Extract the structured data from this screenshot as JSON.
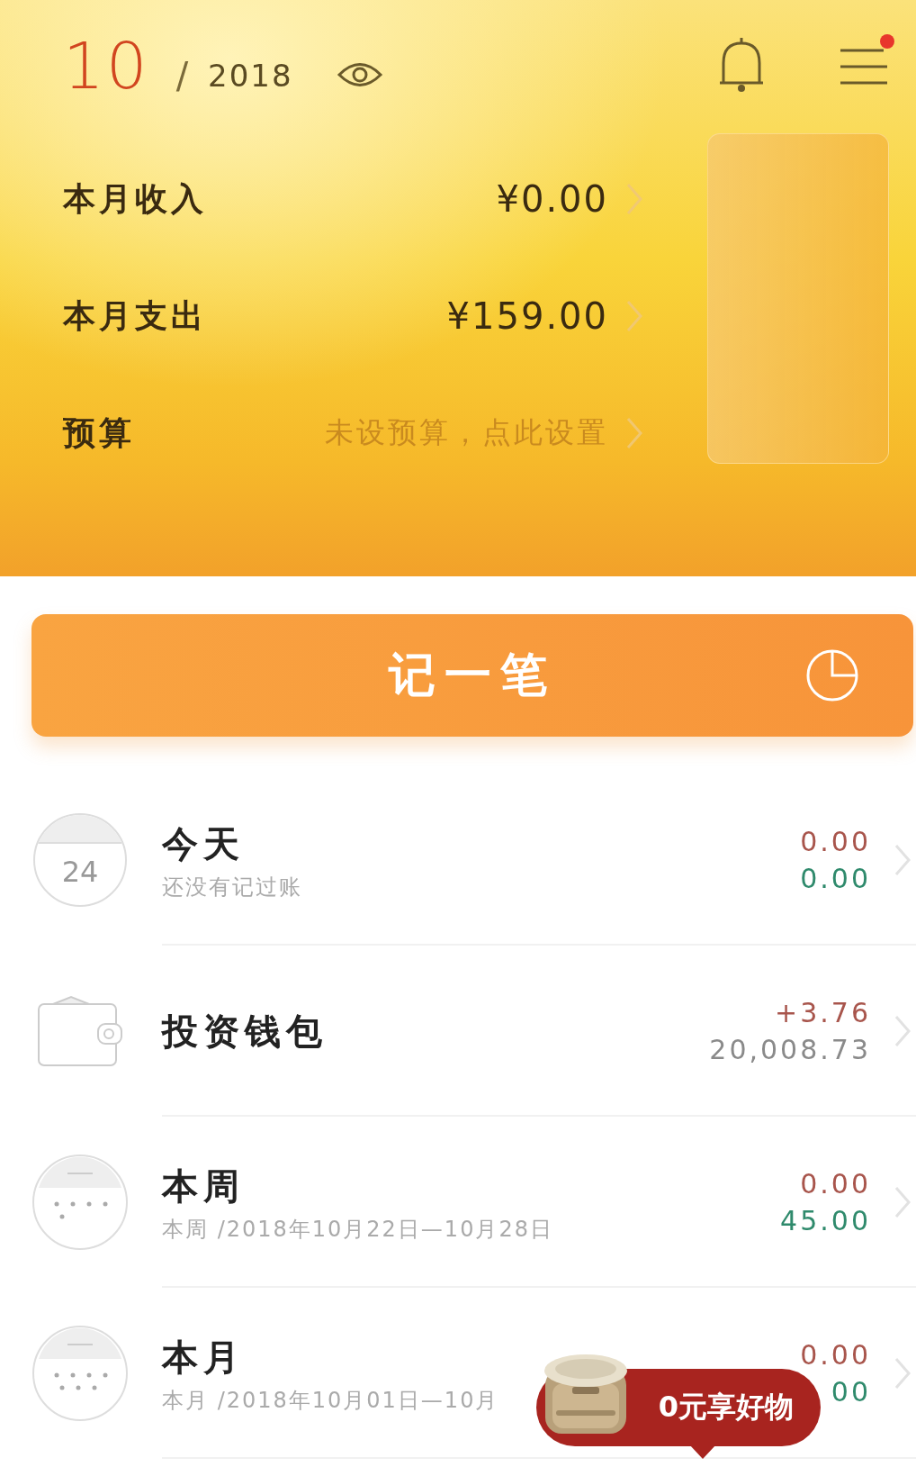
{
  "header": {
    "month": "10",
    "separator": "/",
    "year": "2018",
    "menu_badge": true,
    "rows": [
      {
        "kind": "amount",
        "label": "本月收入",
        "value": "¥0.00"
      },
      {
        "kind": "amount",
        "label": "本月支出",
        "value": "¥159.00"
      },
      {
        "kind": "hint",
        "label": "预算",
        "value": "未设预算，点此设置"
      }
    ]
  },
  "record_button": {
    "label": "记一笔"
  },
  "entries": [
    {
      "kind": "calendar",
      "day": "24",
      "title": "今天",
      "subtitle": "还没有记过账",
      "values": [
        {
          "text": "0.00",
          "color": "#a8554c"
        },
        {
          "text": "0.00",
          "color": "#2f8a6c"
        }
      ]
    },
    {
      "kind": "wallet",
      "title": "投资钱包",
      "values": [
        {
          "text": "+3.76",
          "color": "#a8554c"
        },
        {
          "text": "20,008.73",
          "color": "#8a8a8a"
        }
      ]
    },
    {
      "kind": "week",
      "title": "本周",
      "subtitle": "本周 /2018年10月22日—10月28日",
      "values": [
        {
          "text": "0.00",
          "color": "#a8554c"
        },
        {
          "text": "45.00",
          "color": "#2f8a6c"
        }
      ]
    },
    {
      "kind": "month",
      "title": "本月",
      "subtitle": "本月 /2018年10月01日—10月",
      "values": [
        {
          "text": "0.00",
          "color": "#a8554c"
        },
        {
          "text": "00",
          "color": "#2f8a6c"
        }
      ]
    }
  ],
  "promo": {
    "label": "0元享好物"
  }
}
